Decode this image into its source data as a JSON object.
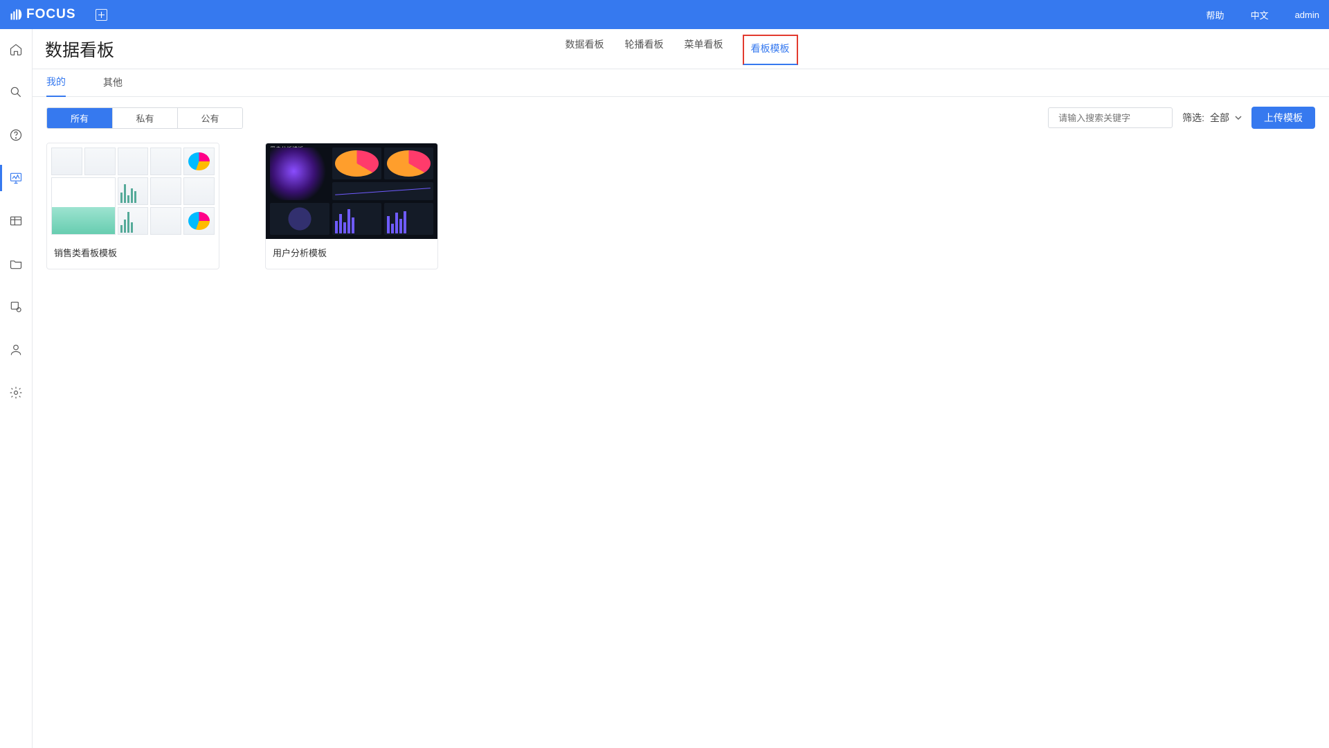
{
  "brand": "FOCUS",
  "top": {
    "help": "帮助",
    "lang": "中文",
    "user": "admin"
  },
  "page_title": "数据看板",
  "nav_tabs": [
    "数据看板",
    "轮播看板",
    "菜单看板",
    "看板模板"
  ],
  "nav_active_index": 3,
  "sub_tabs": [
    "我的",
    "其他"
  ],
  "sub_active_index": 0,
  "segments": [
    "所有",
    "私有",
    "公有"
  ],
  "segment_active_index": 0,
  "search": {
    "placeholder": "请输入搜索关键字"
  },
  "filter": {
    "label": "筛选:",
    "value": "全部"
  },
  "upload_label": "上传模板",
  "cards": [
    {
      "name": "销售类看板模板",
      "style": "light"
    },
    {
      "name": "用户分析模板",
      "style": "dark",
      "thumb_title": "用户分析模板"
    }
  ],
  "sidebar_icons": [
    "home",
    "search",
    "help",
    "dashboard",
    "table",
    "folder",
    "component",
    "user",
    "settings"
  ],
  "sidebar_active_index": 3
}
